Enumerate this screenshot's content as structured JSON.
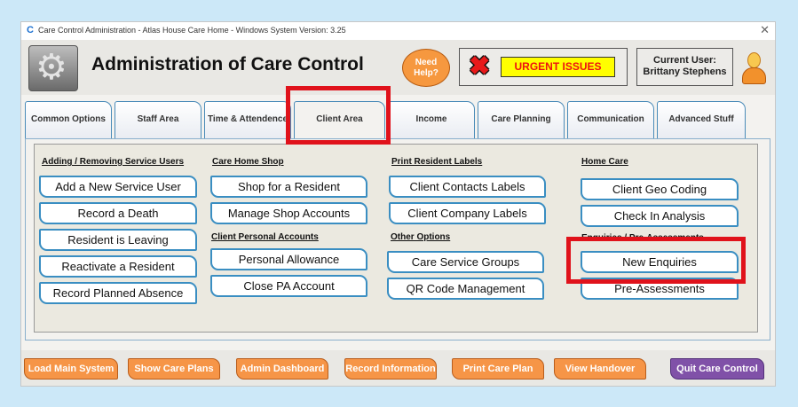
{
  "window": {
    "title": "Care Control Administration - Atlas House Care Home - Windows System Version: 3.25",
    "app_icon": "C",
    "close_glyph": "✕"
  },
  "header": {
    "title": "Administration of Care Control",
    "help": "Need Help?",
    "urgent": "URGENT ISSUES",
    "user_label": "Current User:",
    "user_name": "Brittany Stephens"
  },
  "tabs": [
    {
      "label": "Common Options"
    },
    {
      "label": "Staff Area"
    },
    {
      "label": "Time & Attendence"
    },
    {
      "label": "Client Area",
      "active": true
    },
    {
      "label": "Income"
    },
    {
      "label": "Care Planning"
    },
    {
      "label": "Communication"
    },
    {
      "label": "Advanced Stuff"
    }
  ],
  "client_area": {
    "col1": {
      "heading": "Adding / Removing Service Users",
      "buttons": [
        "Add a New Service User",
        "Record a Death",
        "Resident is Leaving",
        "Reactivate a Resident",
        "Record Planned Absence"
      ]
    },
    "col2": {
      "heading": "Care Home Shop",
      "buttons": [
        "Shop for a Resident",
        "Manage Shop Accounts"
      ],
      "heading2": "Client Personal Accounts",
      "buttons2": [
        "Personal Allowance",
        "Close PA Account"
      ]
    },
    "col3": {
      "heading": "Print Resident Labels",
      "buttons": [
        "Client Contacts Labels",
        "Client Company Labels"
      ],
      "heading2": "Other Options",
      "buttons2": [
        "Care Service Groups",
        "QR Code Management"
      ]
    },
    "col4": {
      "heading": "Home Care",
      "buttons": [
        "Client Geo Coding",
        "Check In Analysis"
      ],
      "heading2": "Enquiries / Pre-Assessments",
      "buttons2": [
        "New Enquiries",
        "Pre-Assessments"
      ]
    }
  },
  "bottom": {
    "buttons": [
      "Load Main System",
      "Show Care Plans",
      "Admin Dashboard",
      "Record Information",
      "Print Care Plan",
      "View Handover"
    ],
    "quit": "Quit Care Control"
  },
  "colors": {
    "button_border": "#3a8ec2",
    "bottom_button": "#f69547",
    "quit_button": "#8051a8",
    "highlight": "#e0121b",
    "urgent_bg": "#ffff00"
  }
}
